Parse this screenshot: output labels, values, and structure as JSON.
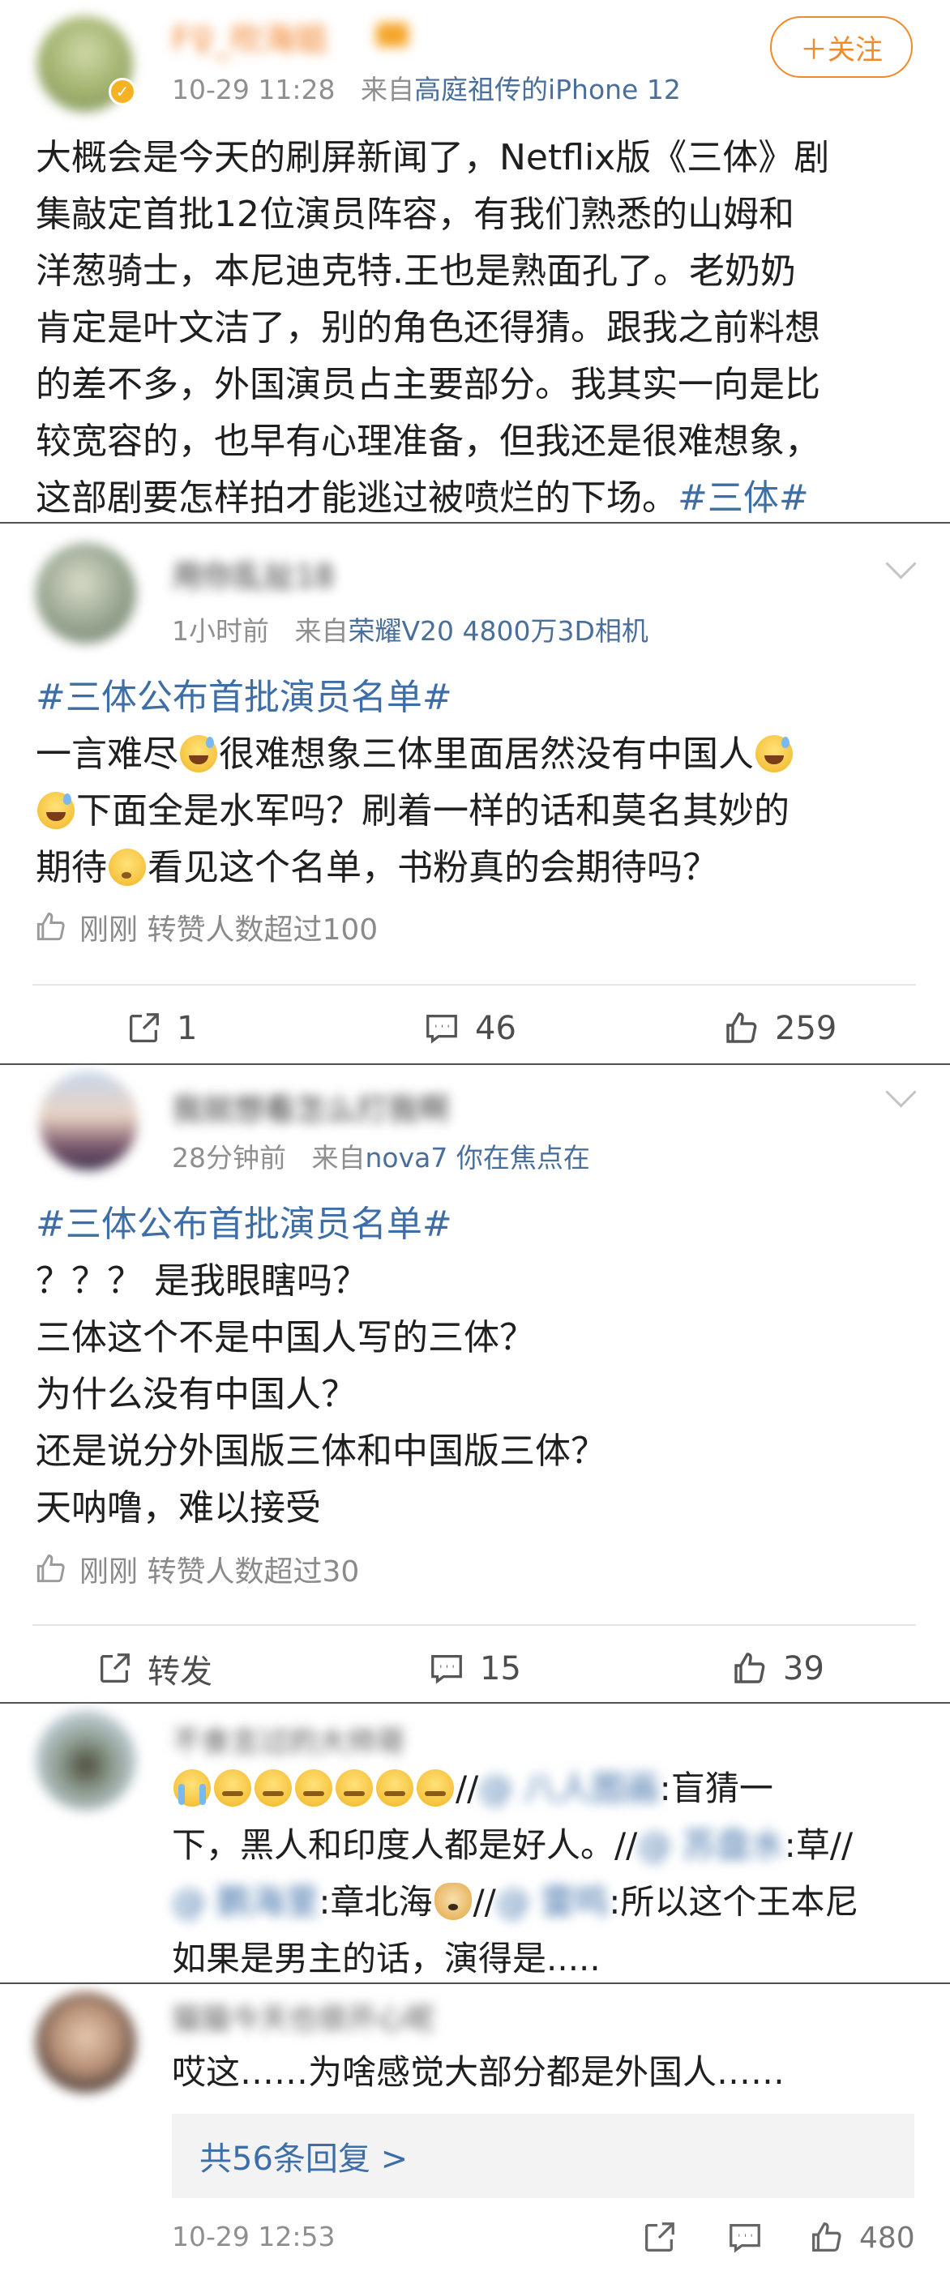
{
  "post": {
    "author_name": "F♀_吹海姐",
    "timestamp": "10-29 11:28",
    "source_prefix": "来自",
    "source": "高庭祖传的iPhone 12",
    "follow_label": "＋关注",
    "text_lines": [
      "大概会是今天的刷屏新闻了，Netflix版《三体》剧",
      "集敲定首批12位演员阵容，有我们熟悉的山姆和",
      "洋葱骑士，本尼迪克特.王也是熟面孔了。老奶奶",
      "肯定是叶文洁了，别的角色还得猜。跟我之前料想",
      "的差不多，外国演员占主要部分。我其实一向是比",
      "较宽容的，也早有心理准备，但我还是很难想象，"
    ],
    "text_last": "这部剧要怎样拍才能逃过被喷烂的下场。",
    "topic": "#三体#"
  },
  "comments": [
    {
      "author_name": "用你乱扯18",
      "time": "1小时前",
      "source_prefix": "来自",
      "source": "荣耀V20 4800万3D相机",
      "topic": "#三体公布首批演员名单#",
      "line1_a": "一言难尽",
      "line1_b": "很难想象三体里面居然没有中国人",
      "line2": "下面全是水军吗？刷着一样的话和莫名其妙的",
      "line3_a": "期待",
      "line3_b": "看见这个名单，书粉真的会期待吗？",
      "like_status": "刚刚 转赞人数超过100",
      "repost_count": "1",
      "comment_count": "46",
      "like_count": "259"
    },
    {
      "author_name": "我就想看怎么打我啊",
      "time": "28分钟前",
      "source_prefix": "来自",
      "source": "nova7 你在焦点在",
      "topic": "#三体公布首批演员名单#",
      "lines": [
        "？？？ 是我眼瞎吗？",
        "三体这个不是中国人写的三体？",
        "为什么没有中国人？",
        "还是说分外国版三体和中国版三体？",
        "天呐噜，难以接受"
      ],
      "like_status": "刚刚 转赞人数超过30",
      "repost_label": "转发",
      "comment_count": "15",
      "like_count": "39"
    }
  ],
  "reply1": {
    "author_name": "不食言过的大帅哥",
    "line1_sep": "//",
    "line1_mention": "@ 八人图画",
    "line1_text": ":盲猜一",
    "line2_text": "下，黑人和印度人都是好人。//",
    "line2_mention": "@ 苏盘水",
    "line2_tail": ":草//",
    "line3_mention": "@ 鹏海里",
    "line3_text": ":章北海",
    "line3_sep": "//",
    "line3_mention2": "@ 雷鸣",
    "line3_tail": ":所以这个王本尼",
    "line4": "如果是男主的话，演得是....."
  },
  "reply2": {
    "author_name": "猫猫今天也很开心呢",
    "text": "哎这……为啥感觉大部分都是外国人……",
    "more_replies": "共56条回复 >",
    "time": "10-29 12:53",
    "like_count": "480"
  },
  "icons": {
    "verified_badge": "verified-badge-icon",
    "vip_crown": "vip-crown-icon",
    "share": "share-icon",
    "comment": "comment-icon",
    "like": "thumbs-up-icon",
    "chevron": "chevron-down-icon"
  },
  "colors": {
    "accent_orange": "#f08a2a",
    "link_blue": "#3d6ea8",
    "source_blue": "#4a6f9a",
    "meta_gray": "#8f8f8f"
  }
}
